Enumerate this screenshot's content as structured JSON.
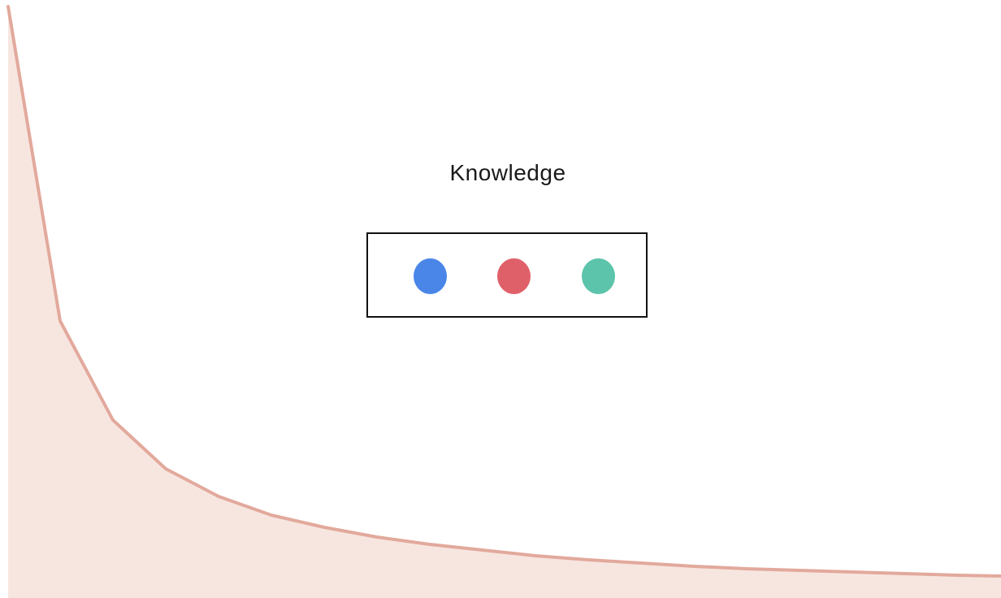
{
  "diagram": {
    "title": "Knowledge",
    "dots": [
      {
        "name": "blue-dot",
        "color": "#4a86e8"
      },
      {
        "name": "red-dot",
        "color": "#e06069"
      },
      {
        "name": "green-dot",
        "color": "#5bc4aa"
      }
    ],
    "curve": {
      "stroke": "#e2a99c",
      "fill": "#f7e6e0"
    }
  }
}
